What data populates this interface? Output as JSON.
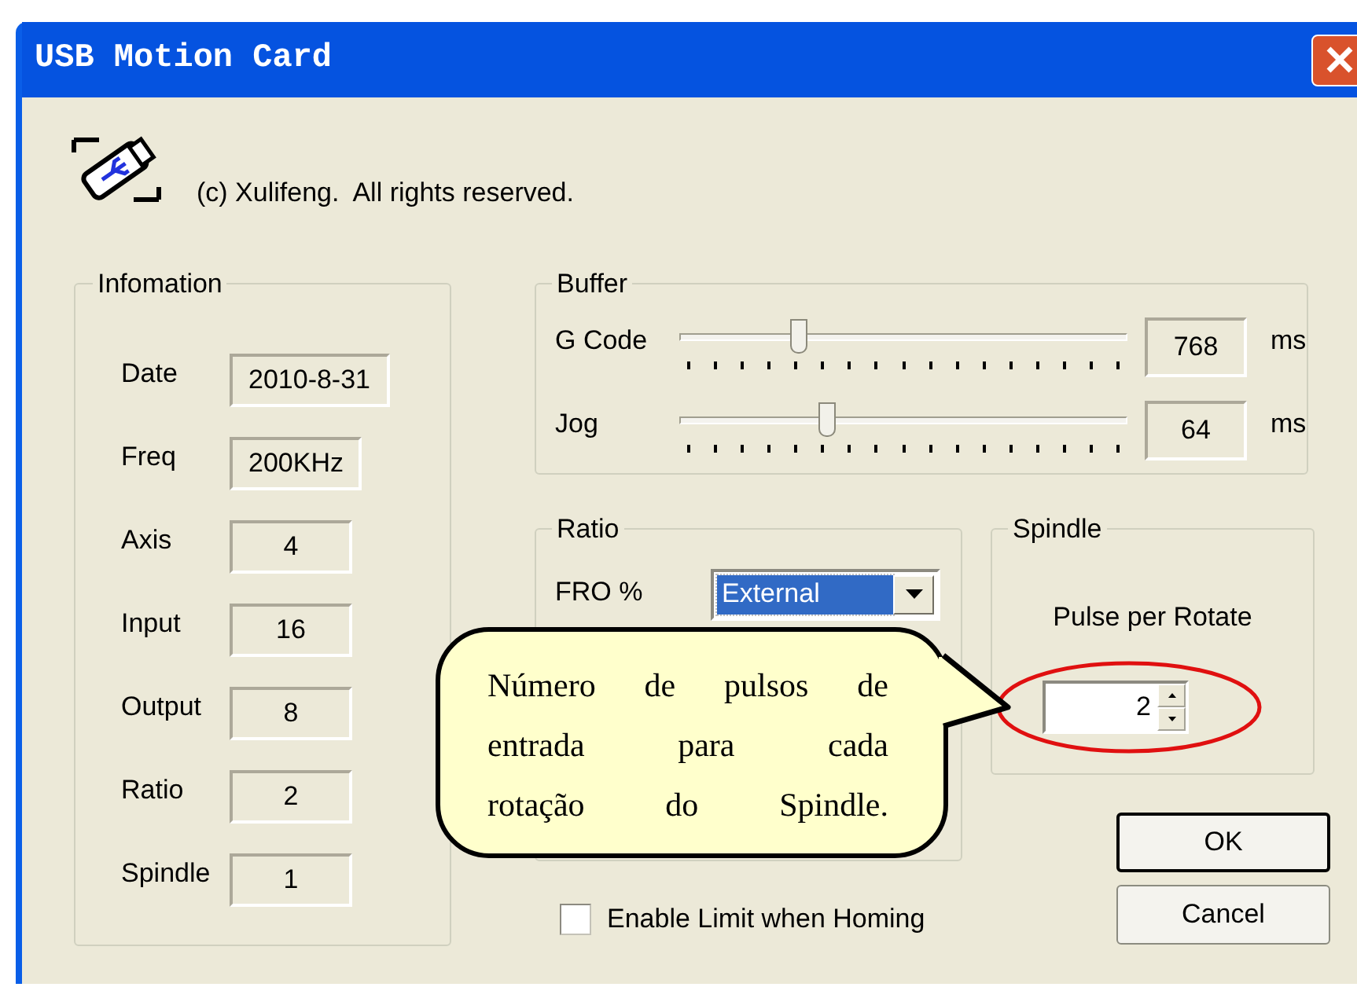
{
  "window": {
    "title": "USB Motion Card"
  },
  "copyright": "(c) Xulifeng.  All rights reserved.",
  "information": {
    "title": "Infomation",
    "fields": [
      {
        "label": "Date",
        "value": "2010-8-31"
      },
      {
        "label": "Freq",
        "value": "200KHz"
      },
      {
        "label": "Axis",
        "value": "4"
      },
      {
        "label": "Input",
        "value": "16"
      },
      {
        "label": "Output",
        "value": "8"
      },
      {
        "label": "Ratio",
        "value": "2"
      },
      {
        "label": "Spindle",
        "value": "1"
      }
    ]
  },
  "buffer": {
    "title": "Buffer",
    "sliders": [
      {
        "label": "G Code",
        "level": 0.265,
        "value": "768",
        "unit": "ms"
      },
      {
        "label": "Jog",
        "level": 0.33,
        "value": "64",
        "unit": "ms"
      }
    ]
  },
  "ratio": {
    "title": "Ratio",
    "fro_label": "FRO %",
    "fro_value": "External",
    "fro_highlighted": true
  },
  "spindle": {
    "title": "Spindle",
    "label": "Pulse per Rotate",
    "value": "2"
  },
  "callout": {
    "lines": [
      "Número de pulsos de",
      "entrada para cada",
      "rotação do Spindle."
    ]
  },
  "checkbox": {
    "label": "Enable Limit when Homing",
    "checked": false
  },
  "buttons": [
    {
      "label": "OK",
      "default": true
    },
    {
      "label": "Cancel",
      "default": false
    }
  ]
}
